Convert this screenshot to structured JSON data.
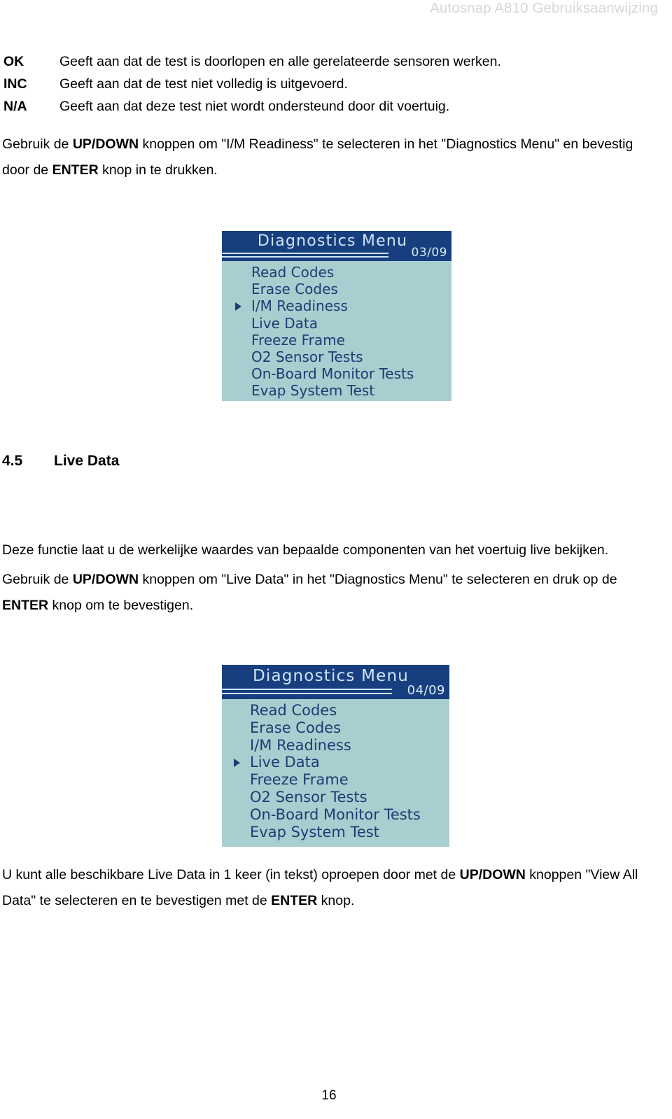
{
  "document": {
    "running_header": "Autosnap A810 Gebruiksaanwijzing",
    "page_number": "16"
  },
  "definitions": [
    {
      "term": "OK",
      "description": "Geeft aan dat de test is doorlopen en alle gerelateerde sensoren werken."
    },
    {
      "term": "INC",
      "description": "Geeft aan dat de test niet volledig is uitgevoerd."
    },
    {
      "term": "N/A",
      "description": "Geeft aan dat deze test niet wordt ondersteund door dit voertuig."
    }
  ],
  "paragraphs": {
    "im_readiness": {
      "part1": "Gebruik de ",
      "bold1": "UP/DOWN",
      "part2": " knoppen om \"I/M Readiness\" te selecteren in het \"Diagnostics Menu\" en bevestig door de ",
      "bold2": "ENTER",
      "part3": " knop in te drukken."
    },
    "live_data_intro": {
      "text": "Deze functie laat u de werkelijke waardes van bepaalde componenten van het voertuig live bekijken."
    },
    "live_data_select": {
      "part1": "Gebruik de ",
      "bold1": "UP/DOWN",
      "part2": " knoppen om \"Live Data\" in het \"Diagnostics Menu\" te selecteren en druk op de ",
      "bold2": "ENTER",
      "part3": " knop om te bevestigen."
    },
    "view_all_data": {
      "part1": "U kunt alle beschikbare Live Data in 1 keer (in tekst) oproepen door met de ",
      "bold1": "UP/DOWN",
      "part2": " knoppen \"View All Data\" te selecteren en te bevestigen met de ",
      "bold2": "ENTER",
      "part3": " knop."
    }
  },
  "section": {
    "number": "4.5",
    "title": "Live Data"
  },
  "lcd_screens": [
    {
      "id": "lcd-1",
      "title": "Diagnostics Menu",
      "page_indicator": "03/09",
      "selected_index": 2,
      "items": [
        "Read Codes",
        "Erase Codes",
        "I/M Readiness",
        "Live Data",
        "Freeze Frame",
        "O2  Sensor Tests",
        "On-Board Monitor Tests",
        "Evap System Test"
      ]
    },
    {
      "id": "lcd-2",
      "title": "Diagnostics Menu",
      "page_indicator": "04/09",
      "selected_index": 3,
      "items": [
        "Read Codes",
        "Erase Codes",
        "I/M Readiness",
        "Live Data",
        "Freeze Frame",
        "O2 Sensor Tests",
        "On-Board Monitor Tests",
        "Evap System Test"
      ]
    }
  ],
  "colors": {
    "lcd_header_bg": "#173f7f",
    "lcd_body_bg": "#a9ced0",
    "lcd_text": "#1b3d72",
    "lcd_title_text": "#cfe3f4",
    "running_header_text": "#d7d7d7"
  }
}
